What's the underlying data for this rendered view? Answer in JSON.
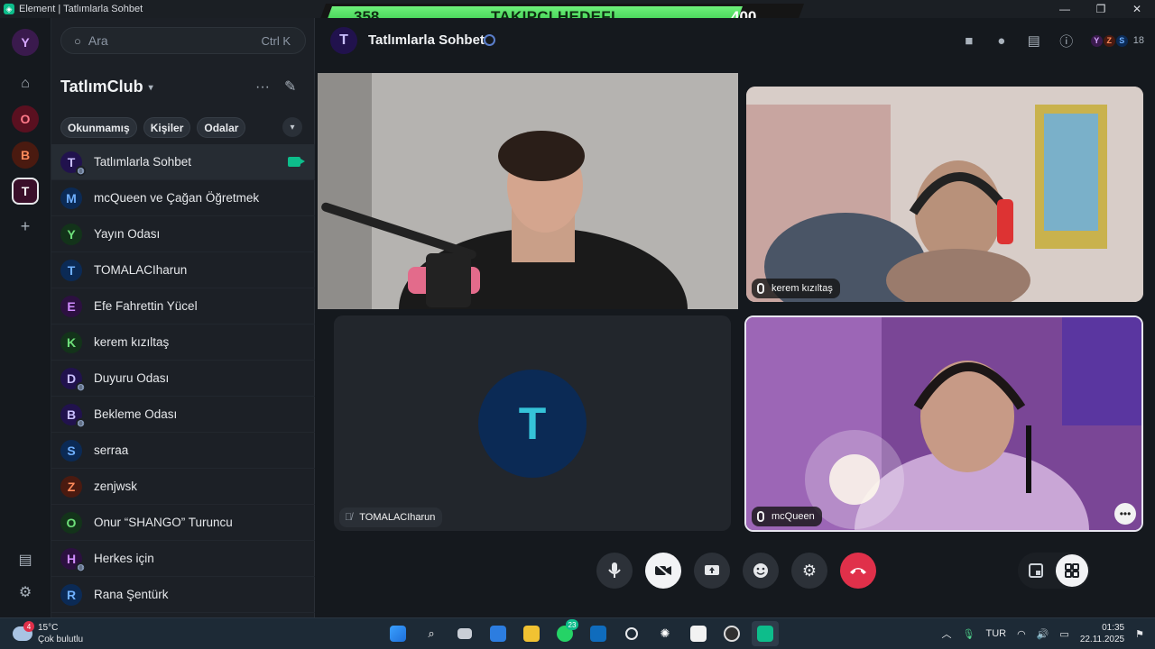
{
  "window": {
    "title": "Element | Tatlımlarla Sohbet",
    "minimize": "—",
    "maximize": "❐",
    "close": "✕"
  },
  "goal_banner": {
    "current": "358",
    "label": "TAKIPÇI HEDEFI",
    "target": "400",
    "progress_fraction": 0.895
  },
  "rail": {
    "spaces": [
      {
        "letter": "Y",
        "bg": "#3a1a4d",
        "fg": "#d7a8ff"
      },
      {
        "letter": "O",
        "bg": "#5a1020",
        "fg": "#ff7a8a"
      },
      {
        "letter": "B",
        "bg": "#4a1a10",
        "fg": "#ff8a5a"
      },
      {
        "letter": "T",
        "bg": "#3a0f2a",
        "fg": "#ffffff"
      }
    ],
    "add": "+"
  },
  "search": {
    "placeholder": "Ara",
    "shortcut": "Ctrl K"
  },
  "space_name": "TatlımClub",
  "filters": [
    "Okunmamış",
    "Kişiler",
    "Odalar"
  ],
  "rooms": [
    {
      "name": "Tatlımlarla Sohbet",
      "letter": "T",
      "bg": "#21124d",
      "fg": "#c9bfff",
      "globe": true,
      "active": true,
      "call": true
    },
    {
      "name": "mcQueen ve Çağan Öğretmek",
      "letter": "M",
      "bg": "#0b2a55",
      "fg": "#6fb0ff",
      "globe": false
    },
    {
      "name": "Yayın Odası",
      "letter": "Y",
      "bg": "#13331a",
      "fg": "#6ee07a",
      "globe": false
    },
    {
      "name": "TOMALACIharun",
      "letter": "T",
      "bg": "#0b2a55",
      "fg": "#6fb0ff",
      "globe": false
    },
    {
      "name": "Efe Fahrettin Yücel",
      "letter": "E",
      "bg": "#2c1040",
      "fg": "#d08cff",
      "globe": false
    },
    {
      "name": "kerem kızıltaş",
      "letter": "K",
      "bg": "#13331a",
      "fg": "#6ee07a",
      "globe": false
    },
    {
      "name": "Duyuru Odası",
      "letter": "D",
      "bg": "#21124d",
      "fg": "#c9bfff",
      "globe": true
    },
    {
      "name": "Bekleme Odası",
      "letter": "B",
      "bg": "#21124d",
      "fg": "#c9bfff",
      "globe": true
    },
    {
      "name": "serraa",
      "letter": "S",
      "bg": "#0b2a55",
      "fg": "#6fb0ff",
      "globe": false
    },
    {
      "name": "zenjwsk",
      "letter": "Z",
      "bg": "#4a1a10",
      "fg": "#ff8a5a",
      "globe": false
    },
    {
      "name": "Onur “SHANGO” Turuncu",
      "letter": "O",
      "bg": "#13331a",
      "fg": "#6ee07a",
      "globe": false
    },
    {
      "name": "Herkes için",
      "letter": "H",
      "bg": "#2c1040",
      "fg": "#d08cff",
      "globe": true
    },
    {
      "name": "Rana Şentürk",
      "letter": "R",
      "bg": "#0b2a55",
      "fg": "#6fb0ff",
      "globe": false
    }
  ],
  "header": {
    "room_letter": "T",
    "room_name": "Tatlımlarla Sohbet",
    "facepile": [
      {
        "letter": "Y",
        "bg": "#3a1a4d",
        "fg": "#d7a8ff"
      },
      {
        "letter": "Z",
        "bg": "#4a1a10",
        "fg": "#ff8a5a"
      },
      {
        "letter": "S",
        "bg": "#0b2a55",
        "fg": "#6fb0ff"
      }
    ],
    "member_count": "18"
  },
  "tiles": {
    "t2_name": "kerem kızıltaş",
    "t3_name": "TOMALACIharun",
    "t3_letter": "T",
    "t4_name": "mcQueen"
  },
  "taskbar": {
    "weather_badge": "4",
    "temp": "15°C",
    "condition": "Çok bulutlu",
    "whatsapp_badge": "23",
    "lang": "TUR",
    "time": "01:35",
    "date": "22.11.2025"
  }
}
